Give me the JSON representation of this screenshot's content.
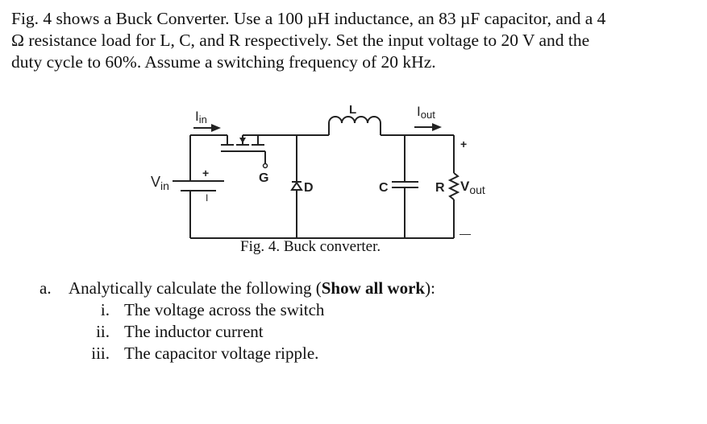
{
  "problem": {
    "line1": "Fig. 4 shows a Buck Converter. Use a 100 µH inductance, an 83 µF capacitor, and a 4",
    "line2": "Ω resistance load for L, C, and R respectively. Set the input voltage to 20 V and the",
    "line3": "duty cycle to 60%. Assume a switching frequency of 20 kHz."
  },
  "figure": {
    "labels": {
      "iin_main": "I",
      "iin_sub": "in",
      "inductor": "L",
      "iout_main": "I",
      "iout_sub": "out",
      "vin_main": "V",
      "vin_sub": "in",
      "gate": "G",
      "diode": "D",
      "capacitor": "C",
      "resistor": "R",
      "vout_main": "V",
      "vout_sub": "out",
      "plus": "+",
      "minus": "—",
      "battery_plus": "+",
      "battery_minus": "I"
    },
    "caption": "Fig. 4. Buck converter."
  },
  "tasks": {
    "marker": "a.",
    "intro_before": "Analytically calculate the following (",
    "intro_bold": "Show all work",
    "intro_after": "):",
    "items": [
      {
        "num": "i.",
        "text": "The voltage across the switch"
      },
      {
        "num": "ii.",
        "text": "The inductor current"
      },
      {
        "num": "iii.",
        "text": "The capacitor voltage ripple."
      }
    ]
  }
}
